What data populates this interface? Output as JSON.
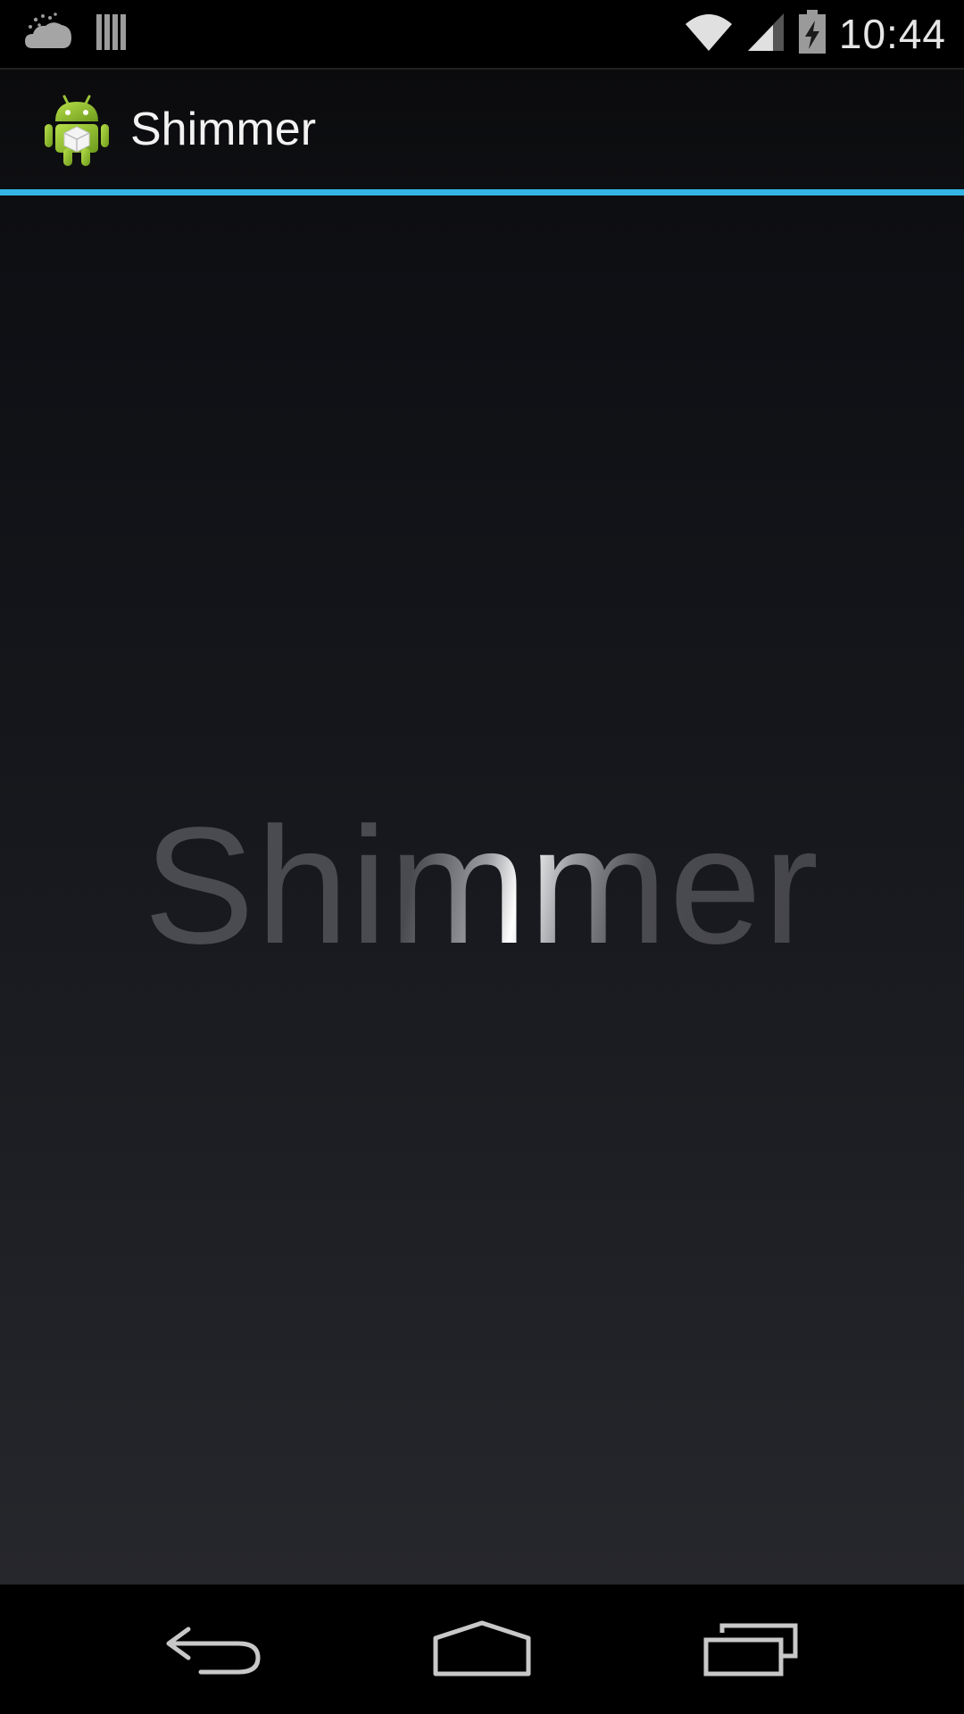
{
  "status_bar": {
    "time": "10:44",
    "icons": [
      "weather-cloud-icon",
      "storage-bars-icon",
      "wifi-icon",
      "signal-icon",
      "battery-charging-icon"
    ]
  },
  "action_bar": {
    "title": "Shimmer",
    "icon": "android-robot-icon",
    "accent_color": "#33b5e5"
  },
  "content": {
    "shimmer_text": "Shimmer"
  },
  "nav_bar": {
    "buttons": [
      "back-icon",
      "home-icon",
      "recent-apps-icon"
    ]
  },
  "colors": {
    "accent": "#33b5e5",
    "background_top": "#0d0e12",
    "background_bottom": "#26272c"
  }
}
